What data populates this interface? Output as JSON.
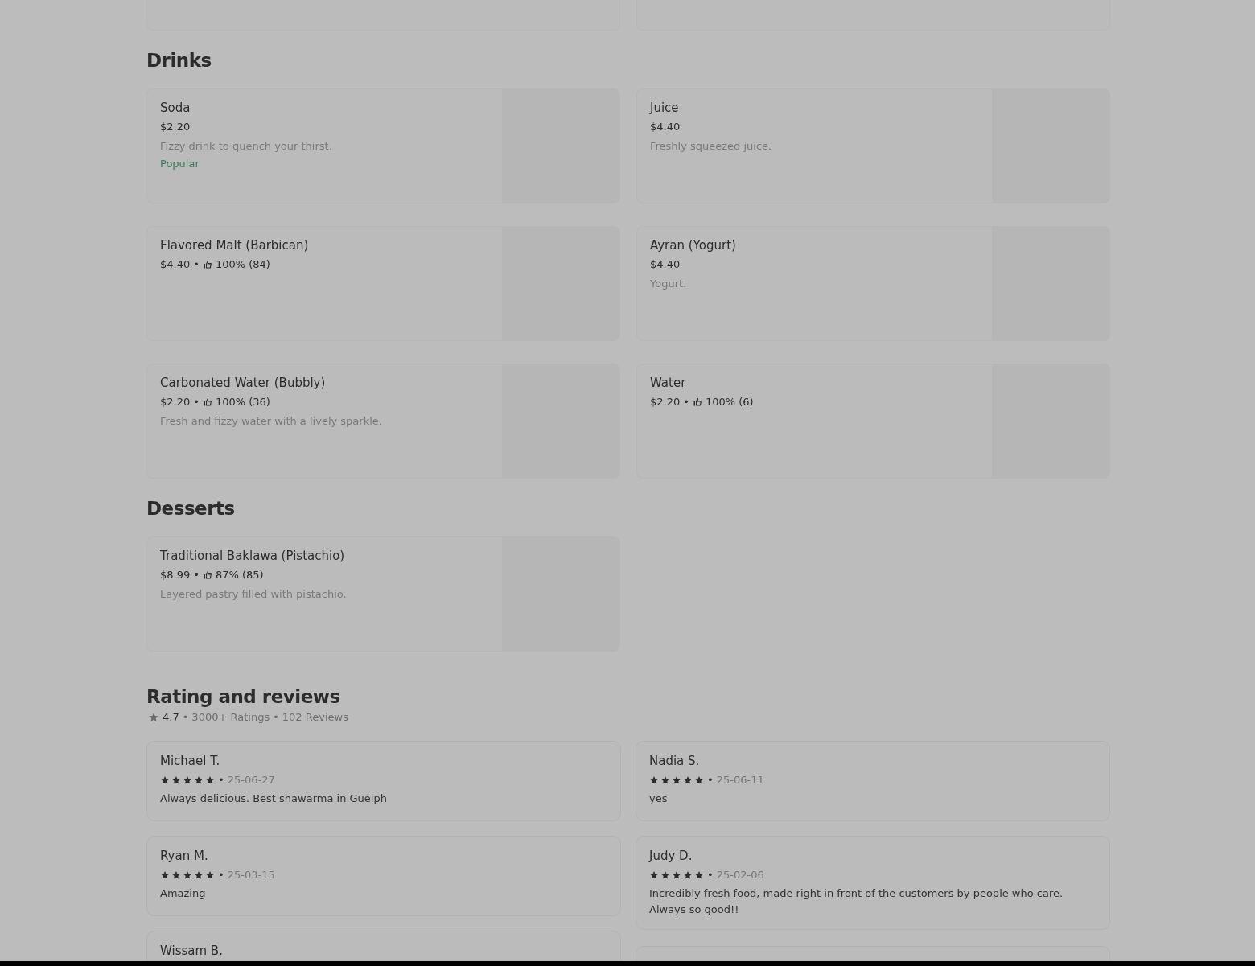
{
  "cut_off_cards": [
    {
      "kind": "menu-item"
    },
    {
      "kind": "menu-item"
    }
  ],
  "sections": [
    {
      "title": "Drinks",
      "items": [
        {
          "name": "Soda",
          "price": "$2.20",
          "description": "Fizzy drink to quench your thirst.",
          "badge": "Popular"
        },
        {
          "name": "Juice",
          "price": "$4.40",
          "description": "Freshly squeezed juice."
        },
        {
          "name": "Flavored Malt (Barbican)",
          "price": "$4.40",
          "approval": "100% (84)"
        },
        {
          "name": "Ayran (Yogurt)",
          "price": "$4.40",
          "description": "Yogurt."
        },
        {
          "name": "Carbonated Water (Bubbly)",
          "price": "$2.20",
          "approval": "100% (36)",
          "description": "Fresh and fizzy water with a lively sparkle."
        },
        {
          "name": "Water",
          "price": "$2.20",
          "approval": "100% (6)"
        }
      ]
    },
    {
      "title": "Desserts",
      "items": [
        {
          "name": "Traditional Baklawa (Pistachio)",
          "price": "$8.99",
          "approval": "87% (85)",
          "description": "Layered pastry filled with pistachio."
        }
      ]
    }
  ],
  "separator": "•",
  "reviews_section": {
    "title": "Rating and reviews",
    "rating": "4.7",
    "ratings_count": "3000+ Ratings",
    "reviews_count": "102 Reviews",
    "columns": [
      [
        {
          "kind": "review",
          "name": "Michael T.",
          "stars": 5,
          "date": "25-06-27",
          "text": "Always delicious. Best shawarma in Guelph"
        },
        {
          "kind": "review",
          "name": "Ryan M.",
          "stars": 5,
          "date": "25-03-15",
          "text": "Amazing"
        },
        {
          "kind": "review",
          "name": "Wissam B."
        }
      ],
      [
        {
          "kind": "review",
          "name": "Nadia S.",
          "stars": 5,
          "date": "25-06-11",
          "text": "yes"
        },
        {
          "kind": "review",
          "name": "Judy D.",
          "stars": 5,
          "date": "25-02-06",
          "text": "Incredibly fresh food, made right in front of the customers by people who care. Always so good!!"
        },
        {
          "kind": "cut-off"
        }
      ]
    ]
  }
}
